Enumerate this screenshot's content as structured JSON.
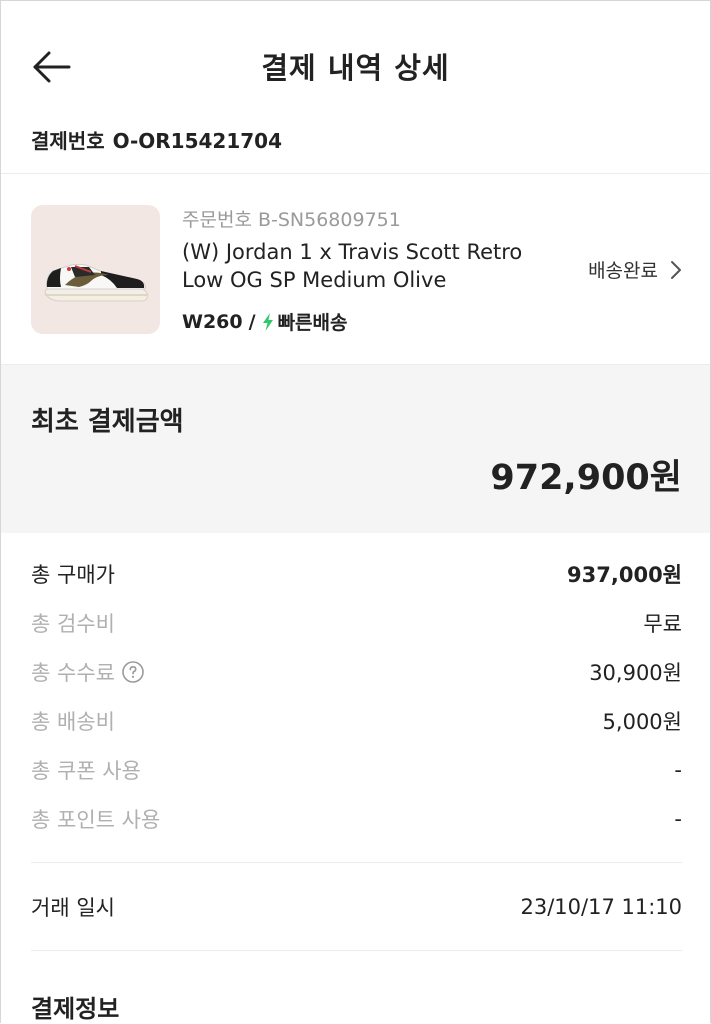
{
  "header": {
    "title": "결제 내역 상세",
    "back_icon": "arrow-left-icon"
  },
  "payment": {
    "label": "결제번호",
    "number": "O-OR15421704"
  },
  "product": {
    "order_number": "주문번호 B-SN56809751",
    "name": "(W) Jordan 1 x Travis Scott Retro Low OG SP Medium Olive",
    "size": "W260",
    "shipping": "빠른배송",
    "status": "배송완료",
    "bolt_color": "#2fc86a"
  },
  "initial_amount": {
    "label": "최초 결제금액",
    "value": "972,900원"
  },
  "breakdown": [
    {
      "label": "총 구매가",
      "value": "937,000원"
    },
    {
      "label": "총 검수비",
      "value": "무료"
    },
    {
      "label": "총 수수료",
      "value": "30,900원"
    },
    {
      "label": "총 배송비",
      "value": "5,000원"
    },
    {
      "label": "총 쿠폰 사용",
      "value": "-"
    },
    {
      "label": "총 포인트 사용",
      "value": "-"
    }
  ],
  "transaction": {
    "label": "거래 일시",
    "value": "23/10/17 11:10"
  },
  "section": {
    "title": "결제정보"
  }
}
